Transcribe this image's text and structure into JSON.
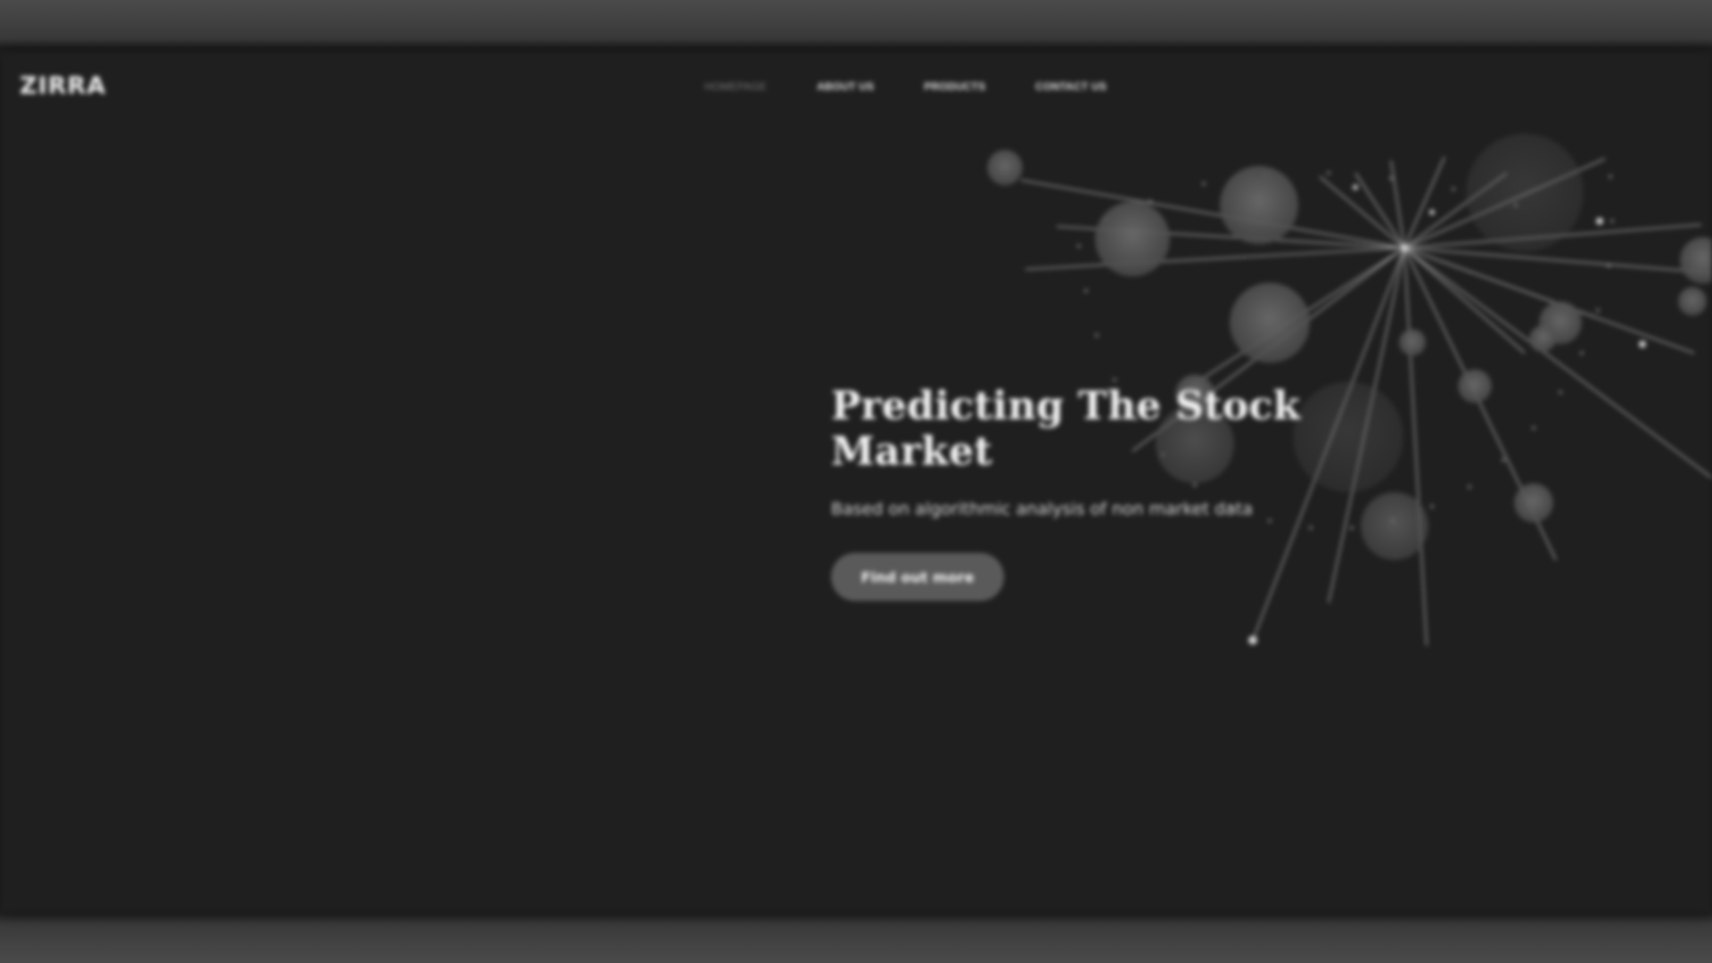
{
  "brand": {
    "logo_text": "ZIRRA"
  },
  "nav": {
    "items": [
      {
        "label": "HOMEPAGE",
        "active": true
      },
      {
        "label": "ABOUT US",
        "active": false
      },
      {
        "label": "PRODUCTS",
        "active": false
      },
      {
        "label": "CONTACT US",
        "active": false
      }
    ]
  },
  "hero": {
    "title": "Predicting The Stock Market",
    "subtitle": "Based on algorithmic analysis of non market data",
    "cta_label": "Find out more"
  },
  "colors": {
    "background": "#1f1f1f",
    "text": "#f3f3f3",
    "button": "#5a5a5a",
    "nav_active": "#7a7a7a"
  },
  "icons": {
    "hero_graphic": "network-graph-icon"
  }
}
